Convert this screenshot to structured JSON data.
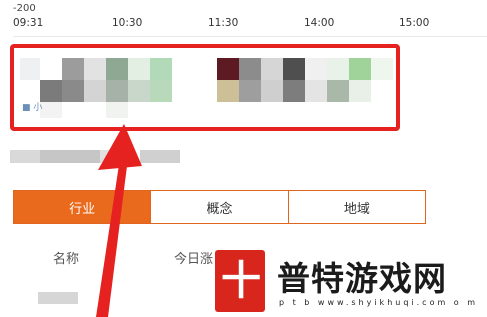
{
  "chart": {
    "y_top_label": "-200",
    "x_ticks": [
      "09:31",
      "10:30",
      "11:30",
      "14:00",
      "15:00"
    ]
  },
  "tabs": [
    {
      "label": "行业",
      "active": true
    },
    {
      "label": "概念",
      "active": false
    },
    {
      "label": "地域",
      "active": false
    }
  ],
  "table": {
    "columns": [
      "名称",
      "今日涨"
    ]
  },
  "highlight": {
    "stub_text": "■ 小"
  },
  "watermark": {
    "logo_glyph": "十",
    "title": "普特游戏网",
    "url": "p t b   www.shyikhuqi.com   o m"
  },
  "colors": {
    "accent": "#e96a1c",
    "highlight_border": "#e5221f",
    "arrow": "#e5221f"
  }
}
